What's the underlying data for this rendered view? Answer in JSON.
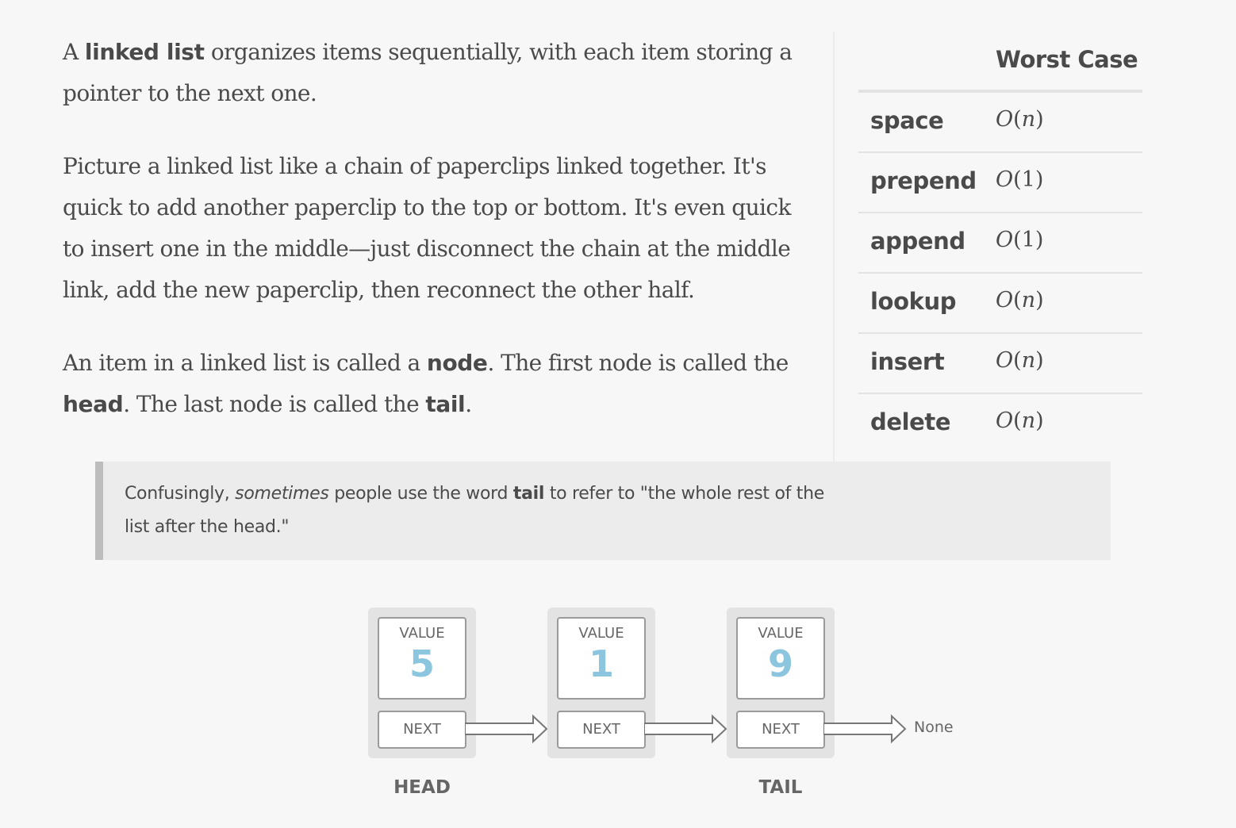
{
  "intro": {
    "p1": [
      {
        "t": "A ",
        "b": false
      },
      {
        "t": "linked list",
        "b": true
      },
      {
        "t": " organizes items sequentially, with each item storing a pointer to the next one.",
        "b": false
      }
    ],
    "p2": [
      {
        "t": "Picture a linked list like a chain of paperclips linked together. It's quick to add another paperclip to the top or bottom. It's even quick to insert one in the middle—just disconnect the chain at the middle link, add the new paperclip, then reconnect the other half.",
        "b": false
      }
    ],
    "p3": [
      {
        "t": "An item in a linked list is called a ",
        "b": false
      },
      {
        "t": "node",
        "b": true
      },
      {
        "t": ". The first node is called the ",
        "b": false
      },
      {
        "t": "head",
        "b": true
      },
      {
        "t": ". The last node is called the ",
        "b": false
      },
      {
        "t": "tail",
        "b": true
      },
      {
        "t": ".",
        "b": false
      }
    ]
  },
  "complexity": {
    "header": "Worst Case",
    "rows": [
      {
        "op": "space",
        "pre": "O(",
        "arg": "n",
        "post": ")"
      },
      {
        "op": "prepend",
        "pre": "O(",
        "arg": "1",
        "post": ")"
      },
      {
        "op": "append",
        "pre": "O(",
        "arg": "1",
        "post": ")"
      },
      {
        "op": "lookup",
        "pre": "O(",
        "arg": "n",
        "post": ")"
      },
      {
        "op": "insert",
        "pre": "O(",
        "arg": "n",
        "post": ")"
      },
      {
        "op": "delete",
        "pre": "O(",
        "arg": "n",
        "post": ")"
      }
    ]
  },
  "callout": {
    "parts": [
      {
        "t": "Confusingly, ",
        "s": ""
      },
      {
        "t": "sometimes",
        "s": "i"
      },
      {
        "t": " people use the word ",
        "s": ""
      },
      {
        "t": "tail",
        "s": "b"
      },
      {
        "t": " to refer to \"the whole rest of the list after the head.\"",
        "s": ""
      }
    ]
  },
  "diagram": {
    "nodes": [
      {
        "value_label": "VALUE",
        "value": "5",
        "next_label": "NEXT",
        "position_label": "HEAD"
      },
      {
        "value_label": "VALUE",
        "value": "1",
        "next_label": "NEXT",
        "position_label": ""
      },
      {
        "value_label": "VALUE",
        "value": "9",
        "next_label": "NEXT",
        "position_label": "TAIL"
      }
    ],
    "terminal": "None",
    "colors": {
      "value": "#8cc5de",
      "node_bg": "#e3e3e3",
      "border": "#9a9a9a"
    }
  }
}
